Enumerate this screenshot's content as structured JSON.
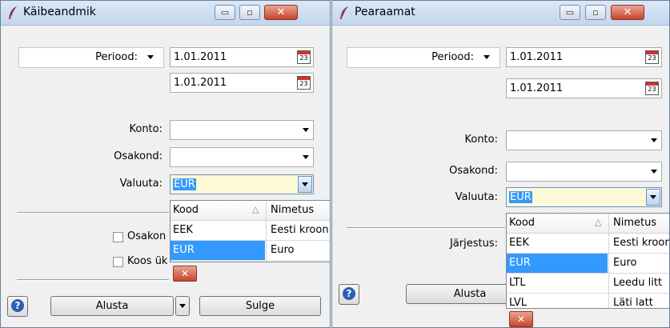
{
  "colors": {
    "selection": "#3399ff",
    "close_red": "#c8442c",
    "combo_highlight": "#fdfbd7"
  },
  "left": {
    "title": "Käibeandmik",
    "period_label": "Periood:",
    "date_from": "1.01.2011",
    "date_to": "1.01.2011",
    "calendar_glyph": "23",
    "konto_label": "Konto:",
    "osakond_label": "Osakond:",
    "valuuta_label": "Valuuta:",
    "valuuta_value": "EUR",
    "checkbox1_label": "Osakon",
    "checkbox2_label": "Koos ük",
    "start_label": "Alusta",
    "close_label": "Sulge",
    "dropdown": {
      "col1": "Kood",
      "col2": "Nimetus",
      "sort_glyph": "△",
      "rows": [
        {
          "code": "EEK",
          "name": "Eesti kroon"
        },
        {
          "code": "EUR",
          "name": "Euro"
        }
      ]
    }
  },
  "right": {
    "title": "Pearaamat",
    "period_label": "Periood:",
    "date_from": "1.01.2011",
    "date_to": "1.01.2011",
    "calendar_glyph": "23",
    "konto_label": "Konto:",
    "osakond_label": "Osakond:",
    "valuuta_label": "Valuuta:",
    "valuuta_value": "EUR",
    "jarjestus_label": "Järjestus:",
    "start_label": "Alusta",
    "dropdown": {
      "col1": "Kood",
      "col2": "Nimetus",
      "sort_glyph": "△",
      "rows": [
        {
          "code": "EEK",
          "name": "Eesti kroon"
        },
        {
          "code": "EUR",
          "name": "Euro"
        },
        {
          "code": "LTL",
          "name": "Leedu litt"
        },
        {
          "code": "LVL",
          "name": "Läti latt"
        }
      ]
    }
  },
  "icons": {
    "minimize": "▭",
    "maximize": "▫",
    "close": "✕",
    "help": "?"
  }
}
